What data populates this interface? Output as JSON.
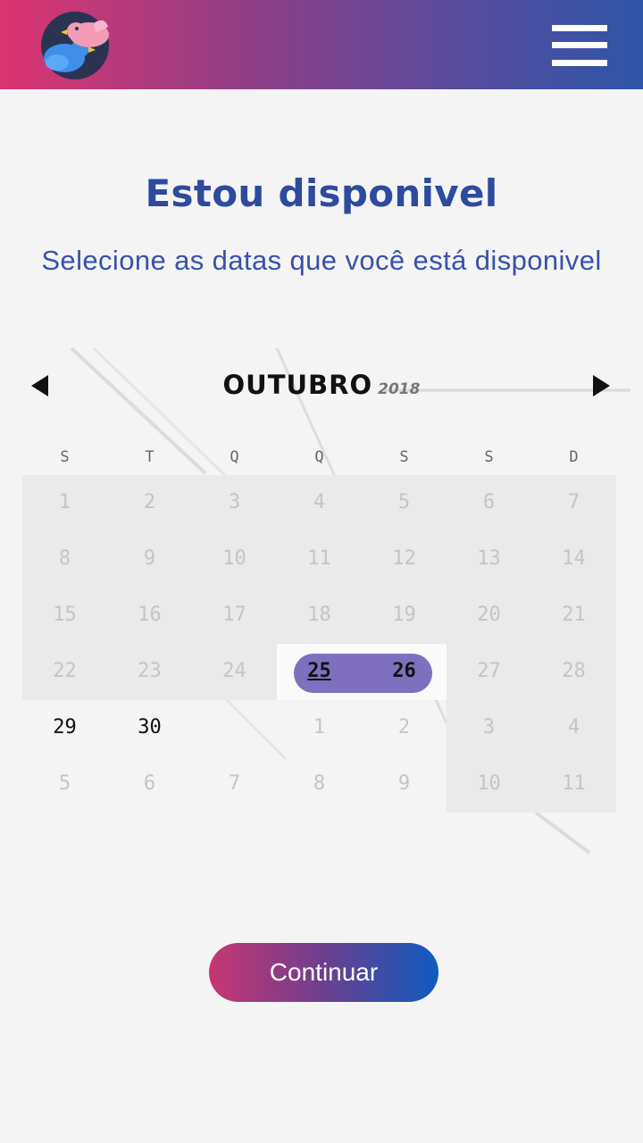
{
  "header": {
    "logo_icon": "birds-logo-icon",
    "menu_icon": "hamburger-menu-icon",
    "gradient": [
      "#dc3470",
      "#2f55a8"
    ]
  },
  "page": {
    "title": "Estou disponivel",
    "subtitle": "Selecione as datas que você está disponivel"
  },
  "calendar": {
    "prev_icon": "triangle-left-icon",
    "next_icon": "triangle-right-icon",
    "month": "OUTUBRO",
    "year": "2018",
    "weekdays": [
      "S",
      "T",
      "Q",
      "Q",
      "S",
      "S",
      "D"
    ],
    "weeks": [
      [
        "1",
        "2",
        "3",
        "4",
        "5",
        "6",
        "7"
      ],
      [
        "8",
        "9",
        "10",
        "11",
        "12",
        "13",
        "14"
      ],
      [
        "15",
        "16",
        "17",
        "18",
        "19",
        "20",
        "21"
      ],
      [
        "22",
        "23",
        "24",
        "25",
        "26",
        "27",
        "28"
      ],
      [
        "29",
        "30",
        "",
        "1",
        "2",
        "3",
        "4"
      ],
      [
        "5",
        "6",
        "7",
        "8",
        "9",
        "10",
        "11"
      ]
    ],
    "selected_dates": [
      "25",
      "26"
    ],
    "today": "25",
    "available_dates": [
      "29",
      "30"
    ],
    "selection_color": "#7e70be"
  },
  "actions": {
    "continue_label": "Continuar"
  }
}
